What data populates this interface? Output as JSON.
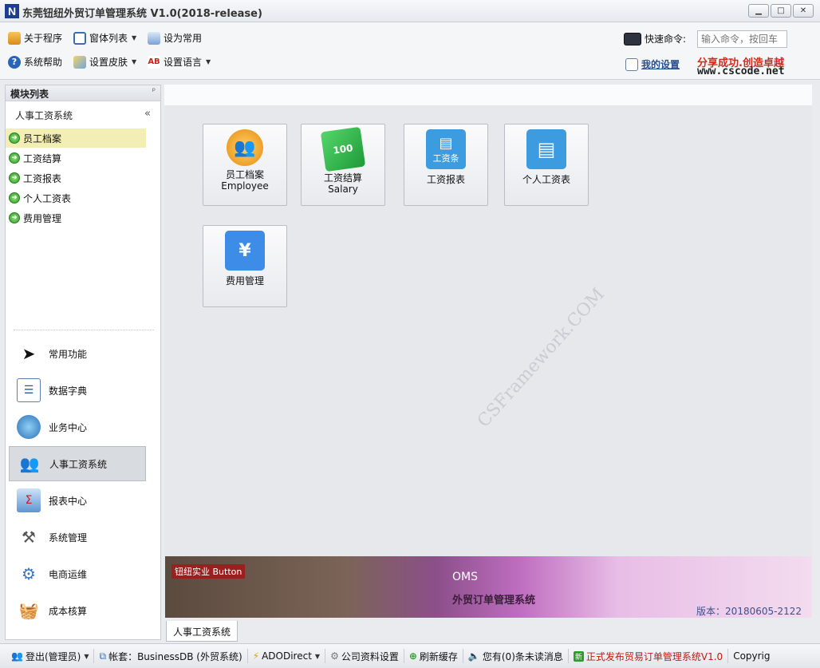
{
  "window": {
    "title": "东莞钮纽外贸订单管理系统 V1.0(2018-release)",
    "logo_letter": "N",
    "minimize": "▁",
    "maximize": "□",
    "close": "✕"
  },
  "toolbar": {
    "about": "关于程序",
    "window_list": "窗体列表",
    "set_common": "设为常用",
    "help": "系统帮助",
    "skin": "设置皮肤",
    "language": "设置语言",
    "quick_cmd_label": "快速命令:",
    "quick_cmd_placeholder": "输入命令，按回车",
    "my_settings": "我的设置",
    "brand_line1": "分享成功.创造卓越",
    "brand_line2": "www.cscode.net"
  },
  "left_panel": {
    "header": "模块列表",
    "pin": "ᵖ",
    "group_title": "人事工资系统",
    "collapse": "«",
    "tree": [
      "员工档案",
      "工资结算",
      "工资报表",
      "个人工资表",
      "费用管理"
    ],
    "nav": [
      {
        "label": "常用功能",
        "icon": "cursor-icon"
      },
      {
        "label": "数据字典",
        "icon": "list-icon"
      },
      {
        "label": "业务中心",
        "icon": "globe-icon"
      },
      {
        "label": "人事工资系统",
        "icon": "people-icon"
      },
      {
        "label": "报表中心",
        "icon": "report-icon"
      },
      {
        "label": "系统管理",
        "icon": "tools-icon"
      },
      {
        "label": "电商运维",
        "icon": "gears-icon"
      },
      {
        "label": "成本核算",
        "icon": "basket-icon"
      }
    ]
  },
  "tiles": [
    {
      "line1": "员工档案",
      "line2": "Employee",
      "icon": "employee-icon",
      "color": "#f2a21b"
    },
    {
      "line1": "工资结算",
      "line2": "Salary",
      "icon": "money-icon",
      "color": "#2fb24c"
    },
    {
      "line1": "工资报表",
      "line2": "",
      "icon": "salary-slip-icon",
      "color": "#3d9be0",
      "badge": "工资条"
    },
    {
      "line1": "个人工资表",
      "line2": "",
      "icon": "personal-salary-icon",
      "color": "#3d9be0"
    },
    {
      "line1": "费用管理",
      "line2": "",
      "icon": "expense-icon",
      "color": "#3d8de8"
    }
  ],
  "watermark": "CSFramework.COM",
  "banner": {
    "tag": "钮纽实业 Button",
    "title": "OMS",
    "subtitle": "外贸订单管理系统",
    "version": "版本：20180605-2122"
  },
  "bottom_tab": "人事工资系统",
  "status": {
    "logout": "登出(管理员)",
    "account": "帐套：BusinessDB (外贸系统)",
    "ado": "ADODirect",
    "company": "公司资料设置",
    "refresh": "刷新缓存",
    "messages": "您有(0)条未读消息",
    "release": "正式发布贸易订单管理系统V1.0",
    "copyright": "Copyrig"
  }
}
